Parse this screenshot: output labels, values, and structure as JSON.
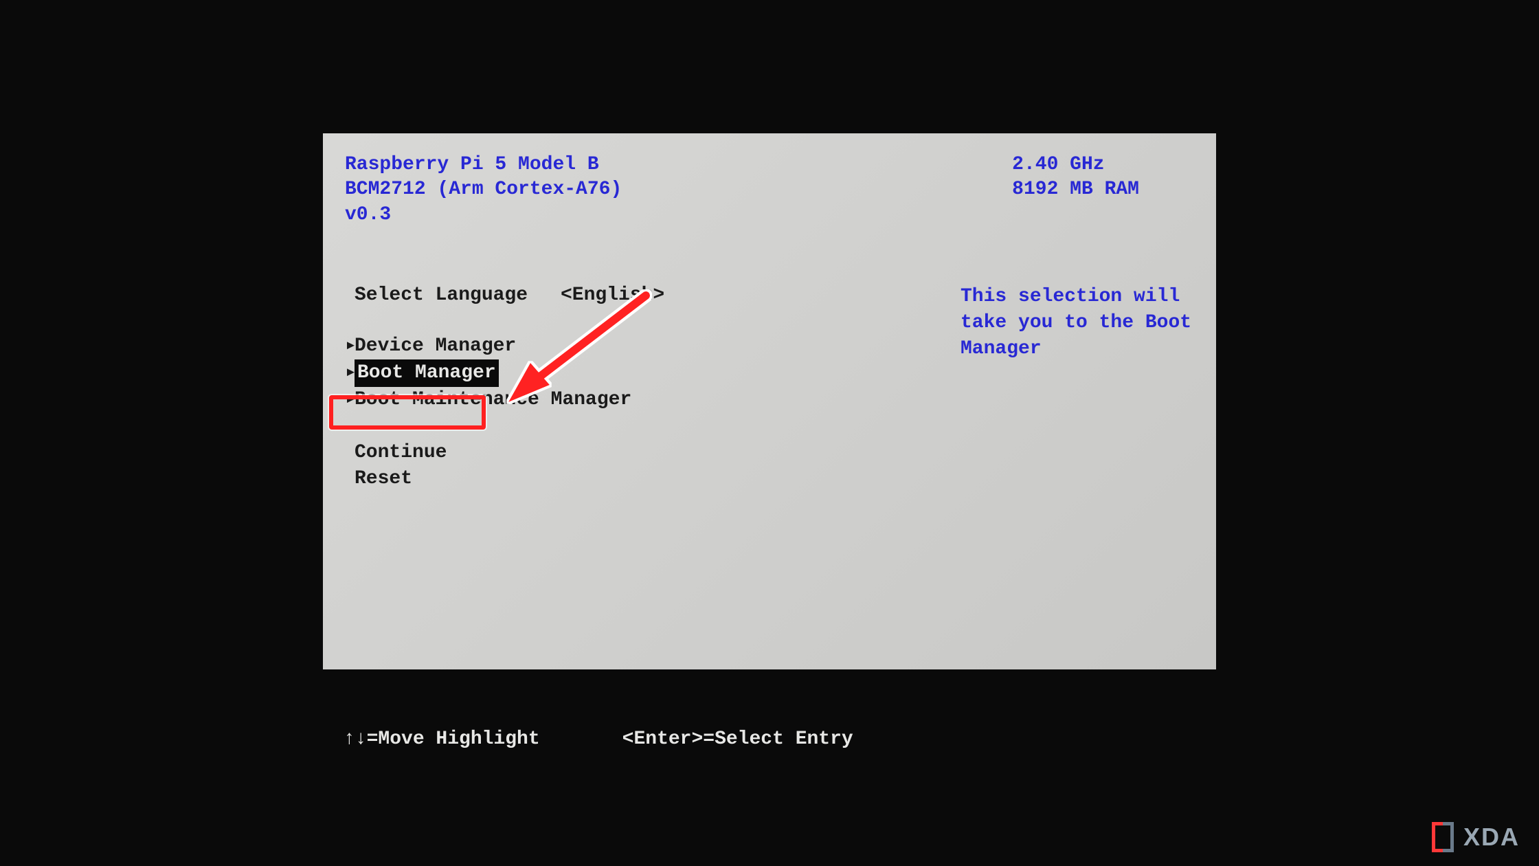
{
  "header": {
    "device_name": "Raspberry Pi 5 Model B",
    "chipset": "BCM2712 (Arm Cortex-A76)",
    "version": "v0.3",
    "cpu_speed": "2.40 GHz",
    "memory": "8192 MB RAM"
  },
  "menu": {
    "language_label": "Select Language",
    "language_value": "<English>",
    "items": [
      {
        "label": "Device Manager",
        "has_caret": true,
        "selected": false
      },
      {
        "label": "Boot Manager",
        "has_caret": true,
        "selected": true
      },
      {
        "label": "Boot Maintenance Manager",
        "has_caret": true,
        "selected": false
      }
    ],
    "continue_label": "Continue",
    "reset_label": "Reset"
  },
  "help": {
    "line1": "This selection will",
    "line2": "take you to the Boot",
    "line3": "Manager"
  },
  "footer": {
    "move_hint": "↑↓=Move Highlight",
    "select_hint": "<Enter>=Select Entry"
  },
  "watermark": {
    "text": "XDA"
  }
}
